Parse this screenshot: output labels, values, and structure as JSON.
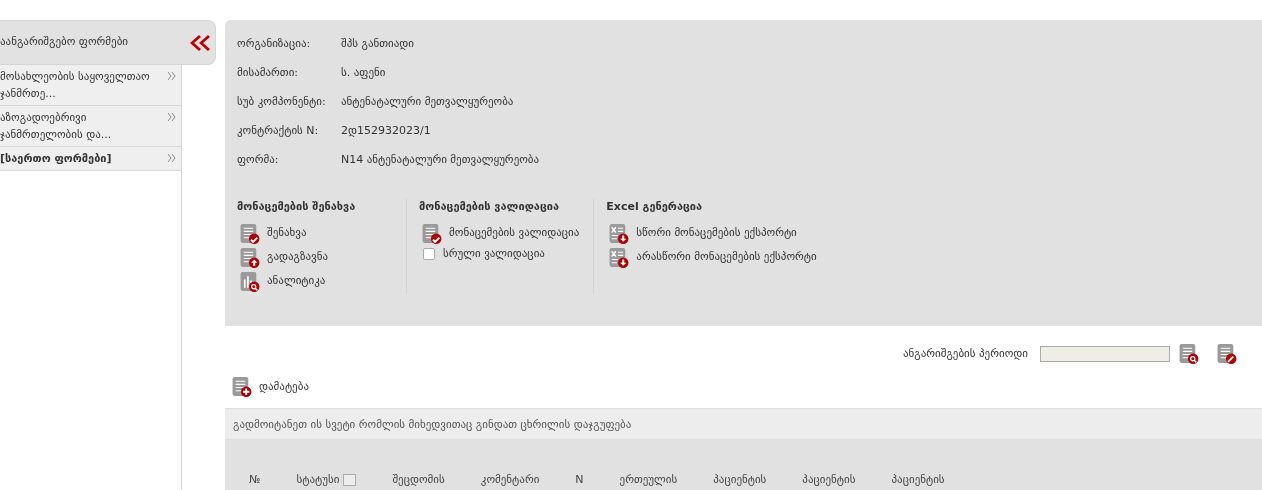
{
  "sidebar": {
    "title": "აანგარიშგებო ფორმები",
    "items": [
      {
        "label": "მოსახლეობის საყოველთაო ჯანმრთე...",
        "bold": false
      },
      {
        "label": "აზოგადოებრივი ჯანმრთელობის და...",
        "bold": false
      },
      {
        "label": "[საერთო ფორმები]",
        "bold": true
      }
    ]
  },
  "info": [
    {
      "label": "ორგანიზაცია:",
      "value": "შპს განთიადი"
    },
    {
      "label": "მისამართი:",
      "value": "ს. აფენი"
    },
    {
      "label": "სუბ კომპონენტი:",
      "value": "ანტენატალური მეთვალყურეობა"
    },
    {
      "label": "კონტრაქტის N:",
      "value": "2დ152932023/1"
    },
    {
      "label": "ფორმა:",
      "value": "N14 ანტენატალური მეთვალყურეობა"
    }
  ],
  "groups": [
    {
      "title": "მონაცემების შენახვა",
      "actions": [
        {
          "kind": "save",
          "label": "შენახვა"
        },
        {
          "kind": "send",
          "label": "გადაგზავნა"
        },
        {
          "kind": "analytics",
          "label": "ანალიტიკა"
        }
      ]
    },
    {
      "title": "მონაცემების ვალიდაცია",
      "actions": [
        {
          "kind": "validate",
          "label": "მონაცემების ვალიდაცია"
        },
        {
          "kind": "checkbox",
          "label": "სრული ვალიდაცია",
          "checked": false
        }
      ]
    },
    {
      "title": "Excel გენერაცია",
      "actions": [
        {
          "kind": "export",
          "label": "სწორი მონაცემების ექსპორტი"
        },
        {
          "kind": "export",
          "label": "არასწორი მონაცემების ექსპორტი"
        }
      ]
    }
  ],
  "period": {
    "label": "ანგარიშგების პერიოდი"
  },
  "add_button": "დამატება",
  "group_hint": "გადმოიტანეთ ის სვეტი რომლის მიხედვითაც გინდათ ცხრილის დაჯგუფება",
  "table": {
    "columns": [
      {
        "label": "№",
        "filter": false
      },
      {
        "label": "სტატუსი",
        "filter": true
      },
      {
        "label": "შეცდომის",
        "filter": false
      },
      {
        "label": "კომენტარი",
        "filter": false
      },
      {
        "label": "N",
        "filter": false
      },
      {
        "label": "ერთეულის",
        "filter": false
      },
      {
        "label": "პაციენტის",
        "filter": false
      },
      {
        "label": "პაციენტის",
        "filter": false
      },
      {
        "label": "პაციენტის",
        "filter": false
      }
    ]
  }
}
